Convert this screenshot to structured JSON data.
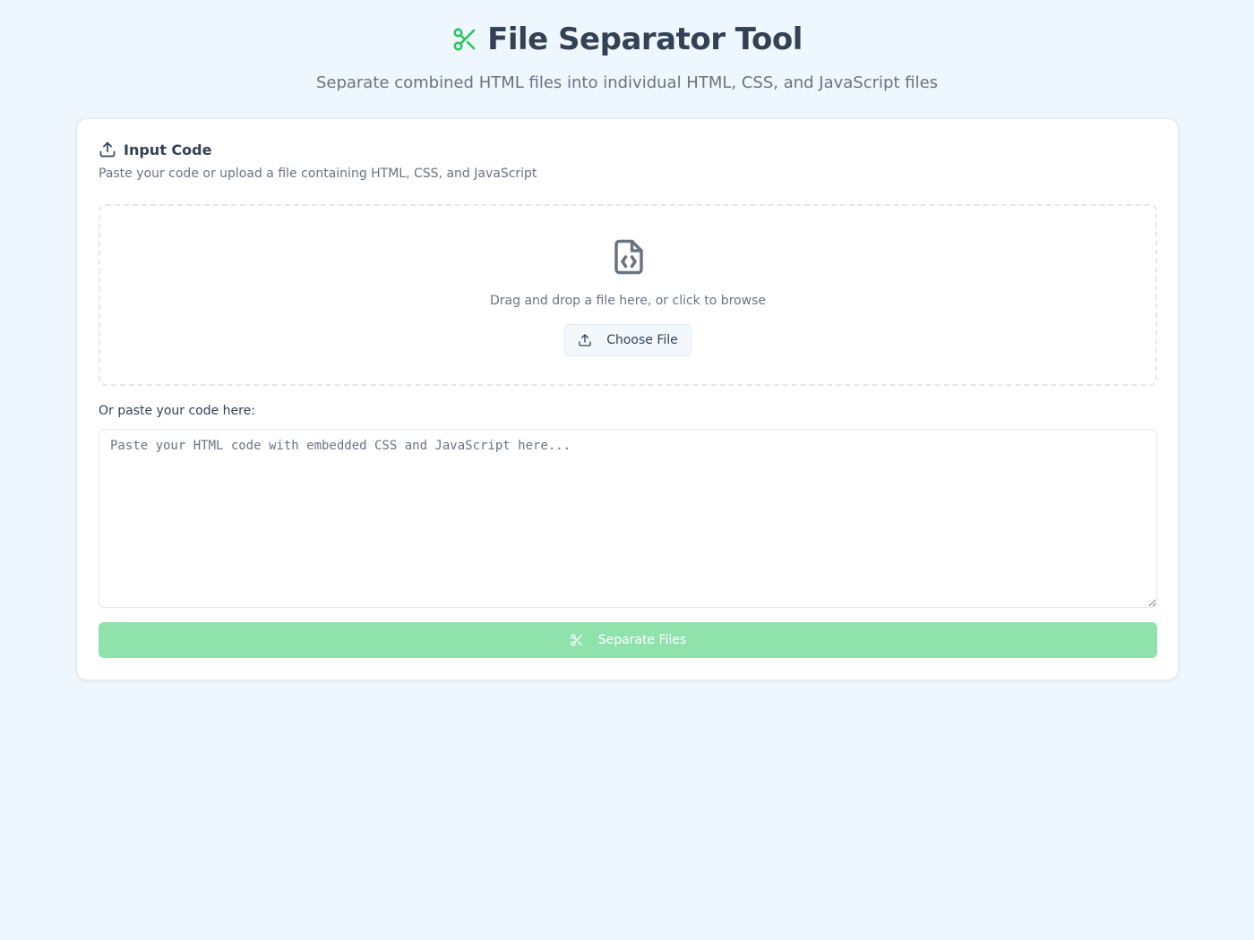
{
  "header": {
    "title": "File Separator Tool",
    "subtitle": "Separate combined HTML files into individual HTML, CSS, and JavaScript files",
    "icon": "scissors-icon"
  },
  "input_card": {
    "title": "Input Code",
    "title_icon": "upload-icon",
    "description": "Paste your code or upload a file containing HTML, CSS, and JavaScript",
    "dropzone": {
      "icon": "file-code-icon",
      "text": "Drag and drop a file here, or click to browse",
      "button_label": "Choose File",
      "button_icon": "upload-icon"
    },
    "paste_label": "Or paste your code here:",
    "textarea": {
      "value": "",
      "placeholder": "Paste your HTML code with embedded CSS and JavaScript here..."
    },
    "separate_button": {
      "label": "Separate Files",
      "icon": "scissors-icon",
      "disabled": true
    }
  },
  "colors": {
    "background": "#eff7fe",
    "accent": "#22c55e",
    "button_disabled": "#90e2ad",
    "text_primary": "#334155",
    "text_muted": "#6b7280"
  }
}
